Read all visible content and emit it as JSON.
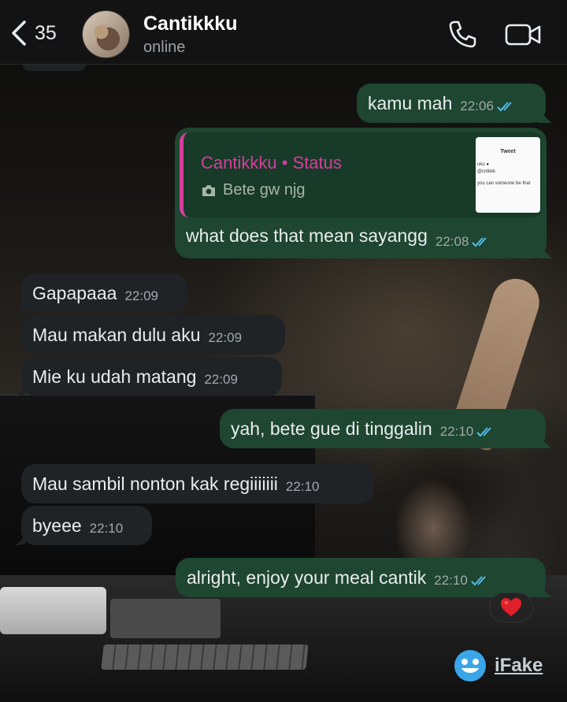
{
  "header": {
    "back_count": "35",
    "contact_name": "Cantikkku",
    "contact_status": "online"
  },
  "status_reply": {
    "quote_title": "Cantikkku • Status",
    "quote_text": "Bete gw njg",
    "thumb_title": "Tweet",
    "thumb_line1": "uku ●",
    "thumb_line2": "@cntkkk",
    "thumb_line3": "you can someone be that",
    "text": "what does that mean sayangg",
    "time": "22:08"
  },
  "messages": [
    {
      "dir": "out",
      "text": "kamu mah",
      "time": "22:06"
    },
    {
      "dir": "in",
      "text": "Gapapaaa",
      "time": "22:09"
    },
    {
      "dir": "in",
      "text": "Mau makan dulu aku",
      "time": "22:09"
    },
    {
      "dir": "in",
      "text": "Mie ku udah matang",
      "time": "22:09"
    },
    {
      "dir": "out",
      "text": "yah, bete gue di tinggalin",
      "time": "22:10"
    },
    {
      "dir": "in",
      "text": "Mau sambil nonton kak regiiiiiii",
      "time": "22:10"
    },
    {
      "dir": "in",
      "text": "byeee",
      "time": "22:10"
    },
    {
      "dir": "out",
      "text": "alright, enjoy your meal cantik",
      "time": "22:10"
    }
  ],
  "reaction": {
    "emoji": "red-heart",
    "color": "#e0202a"
  },
  "watermark": {
    "text": "iFake"
  },
  "colors": {
    "incoming_bubble": "#1f2326",
    "outgoing_bubble": "#1e4630",
    "status_accent": "#d43e9b",
    "read_ticks": "#53bdeb"
  }
}
